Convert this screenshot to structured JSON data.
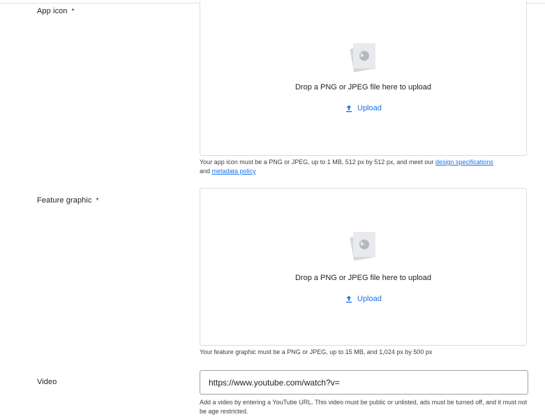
{
  "app_icon": {
    "label": "App icon",
    "required_mark": "*",
    "drop_text": "Drop a PNG or JPEG file here to upload",
    "upload_label": "Upload",
    "helper_text": "Your app icon must be a PNG or JPEG, up to 1 MB, 512 px by 512 px, and meet our ",
    "link_design": "design specifications",
    "helper_and": "and ",
    "link_metadata": "metadata policy"
  },
  "feature_graphic": {
    "label": "Feature graphic",
    "required_mark": "*",
    "drop_text": "Drop a PNG or JPEG file here to upload",
    "upload_label": "Upload",
    "helper_text": "Your feature graphic must be a PNG or JPEG, up to 15 MB, and 1,024 px by 500 px"
  },
  "video": {
    "label": "Video",
    "value": "https://www.youtube.com/watch?v=",
    "helper_text": "Add a video by entering a YouTube URL. This video must be public or unlisted, ads must be turned off, and it must not be age restricted."
  },
  "icons": {
    "placeholder": "image-placeholder-icon",
    "upload": "upload-icon"
  },
  "colors": {
    "link": "#1a73e8",
    "border": "#dadce0",
    "text": "#202124"
  }
}
